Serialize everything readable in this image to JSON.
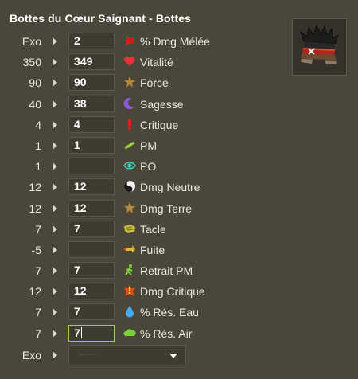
{
  "title": "Bottes du Cœur Saignant - Bottes",
  "item_image": {
    "icon": "boots-item-icon"
  },
  "stats": [
    {
      "base": "Exo",
      "value": "2",
      "label": "% Dmg Mélée",
      "icon": "melee-damage-icon"
    },
    {
      "base": "350",
      "value": "349",
      "label": "Vitalité",
      "icon": "heart-icon"
    },
    {
      "base": "90",
      "value": "90",
      "label": "Force",
      "icon": "strength-icon"
    },
    {
      "base": "40",
      "value": "38",
      "label": "Sagesse",
      "icon": "wisdom-icon"
    },
    {
      "base": "4",
      "value": "4",
      "label": "Critique",
      "icon": "critical-icon"
    },
    {
      "base": "1",
      "value": "1",
      "label": "PM",
      "icon": "movement-point-icon"
    },
    {
      "base": "1",
      "value": "",
      "label": "PO",
      "icon": "range-eye-icon"
    },
    {
      "base": "12",
      "value": "12",
      "label": "Dmg Neutre",
      "icon": "neutral-damage-icon"
    },
    {
      "base": "12",
      "value": "12",
      "label": "Dmg Terre",
      "icon": "earth-damage-icon"
    },
    {
      "base": "7",
      "value": "7",
      "label": "Tacle",
      "icon": "lock-icon"
    },
    {
      "base": "-5",
      "value": "",
      "label": "Fuite",
      "icon": "dodge-icon"
    },
    {
      "base": "7",
      "value": "7",
      "label": "Retrait PM",
      "icon": "mp-reduction-icon"
    },
    {
      "base": "12",
      "value": "12",
      "label": "Dmg Critique",
      "icon": "critical-damage-icon"
    },
    {
      "base": "7",
      "value": "7",
      "label": "% Rés. Eau",
      "icon": "water-resistance-icon"
    },
    {
      "base": "7",
      "value": "7",
      "label": "% Rés. Air",
      "icon": "air-resistance-icon"
    }
  ],
  "exo": {
    "base": "Exo",
    "placeholder": "------"
  },
  "colors": {
    "background": "#4a4639",
    "input_bg": "#3e3b31",
    "focus_border": "#9ecf5a"
  }
}
